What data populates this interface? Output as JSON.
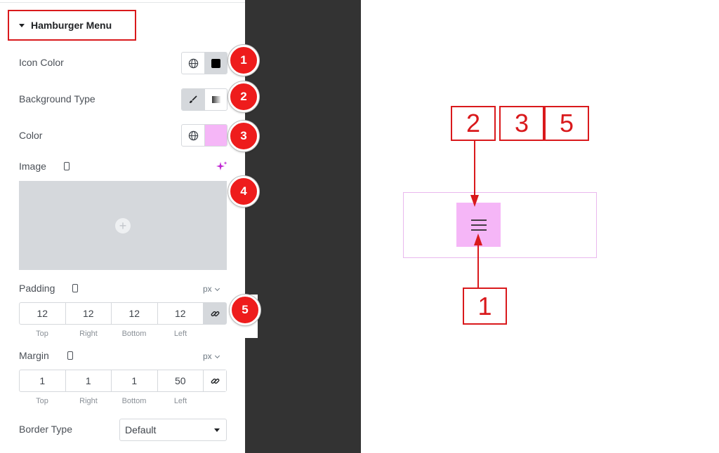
{
  "panel": {
    "section_title": "Hamburger Menu",
    "icon_color_label": "Icon Color",
    "background_type_label": "Background Type",
    "color_label": "Color",
    "image_label": "Image",
    "padding": {
      "label": "Padding",
      "unit": "px",
      "values": [
        "12",
        "12",
        "12",
        "12"
      ],
      "sides": [
        "Top",
        "Right",
        "Bottom",
        "Left"
      ]
    },
    "margin": {
      "label": "Margin",
      "unit": "px",
      "values": [
        "1",
        "1",
        "1",
        "50"
      ],
      "sides": [
        "Top",
        "Right",
        "Bottom",
        "Left"
      ]
    },
    "border_type": {
      "label": "Border Type",
      "selected": "Default"
    }
  },
  "badges": [
    "1",
    "2",
    "3",
    "4",
    "5"
  ],
  "preview": {
    "boxes_top": [
      "2",
      "3",
      "5"
    ],
    "box_bottom": "1"
  },
  "colors": {
    "accent_red": "#d9191c",
    "badge_red": "#ee1c1c",
    "pink": "#f5b6f7",
    "dark_strip": "#333333",
    "icon_black": "#000000"
  },
  "icons": [
    "globe-icon",
    "brush-icon",
    "gradient-icon",
    "mobile-icon",
    "sparkle-icon",
    "plus-icon",
    "link-icon",
    "hamburger-icon"
  ]
}
